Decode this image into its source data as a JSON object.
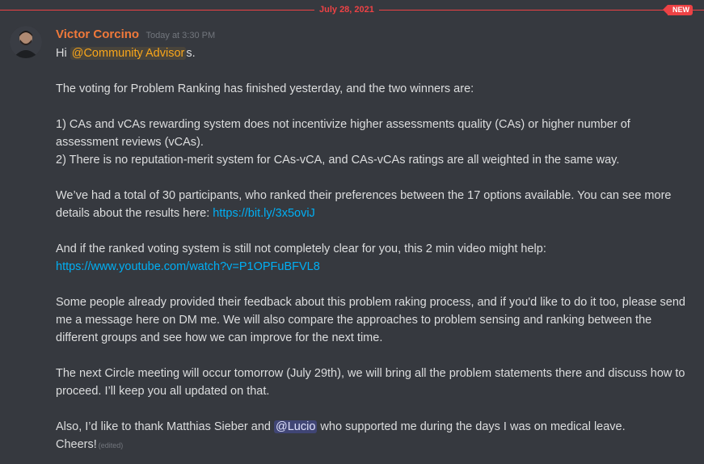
{
  "divider": {
    "date": "July 28, 2021",
    "badge": "NEW"
  },
  "message": {
    "author": "Victor Corcino",
    "timestamp": "Today at 3:30 PM",
    "greeting_prefix": "Hi ",
    "role_mention": "@Community Advisor",
    "greeting_suffix": "s.",
    "para_voting": "The voting for Problem Ranking has finished yesterday, and the two winners are:",
    "winner_1": "1) CAs and vCAs rewarding system does not incentivize higher assessments quality (CAs) or higher number of assessment reviews (vCAs).",
    "winner_2": "2) There is no reputation-merit system for CAs-vCA, and CAs-vCAs ratings are all weighted in the same way.",
    "para_participants": "We’ve had a total of 30 participants, who ranked their preferences between the 17 options available. You can see more details about the results here: ",
    "link_results": "https://bit.ly/3x5oviJ",
    "para_video": "And if the ranked voting system is still not completely clear for you, this 2 min video might help:",
    "link_video": "https://www.youtube.com/watch?v=P1OPFuBFVL8",
    "para_feedback": "Some people already provided their feedback about this problem raking process, and if you'd like to do it too, please send me a message here on DM me. We will also compare the approaches to problem sensing and ranking between the different groups and see how we can improve for the next time.",
    "para_meeting": "The next Circle meeting will occur tomorrow (July 29th), we will bring all the problem statements there and discuss how to proceed. I’ll keep you all updated on that.",
    "thanks_prefix": "Also, I’d like to thank Matthias Sieber and ",
    "user_mention": "@Lucio",
    "thanks_suffix": " who supported me during the days I was on medical leave.",
    "closing": "Cheers!",
    "edited_label": "(edited)"
  },
  "colors": {
    "background": "#36393f",
    "new_divider": "#ed4245",
    "author": "#f0793a",
    "text": "#dcddde",
    "link": "#00aff4",
    "role_mention": "#faa61a",
    "user_mention_bg": "#5865f2"
  },
  "icons": {
    "avatar": "user-avatar-photo"
  }
}
